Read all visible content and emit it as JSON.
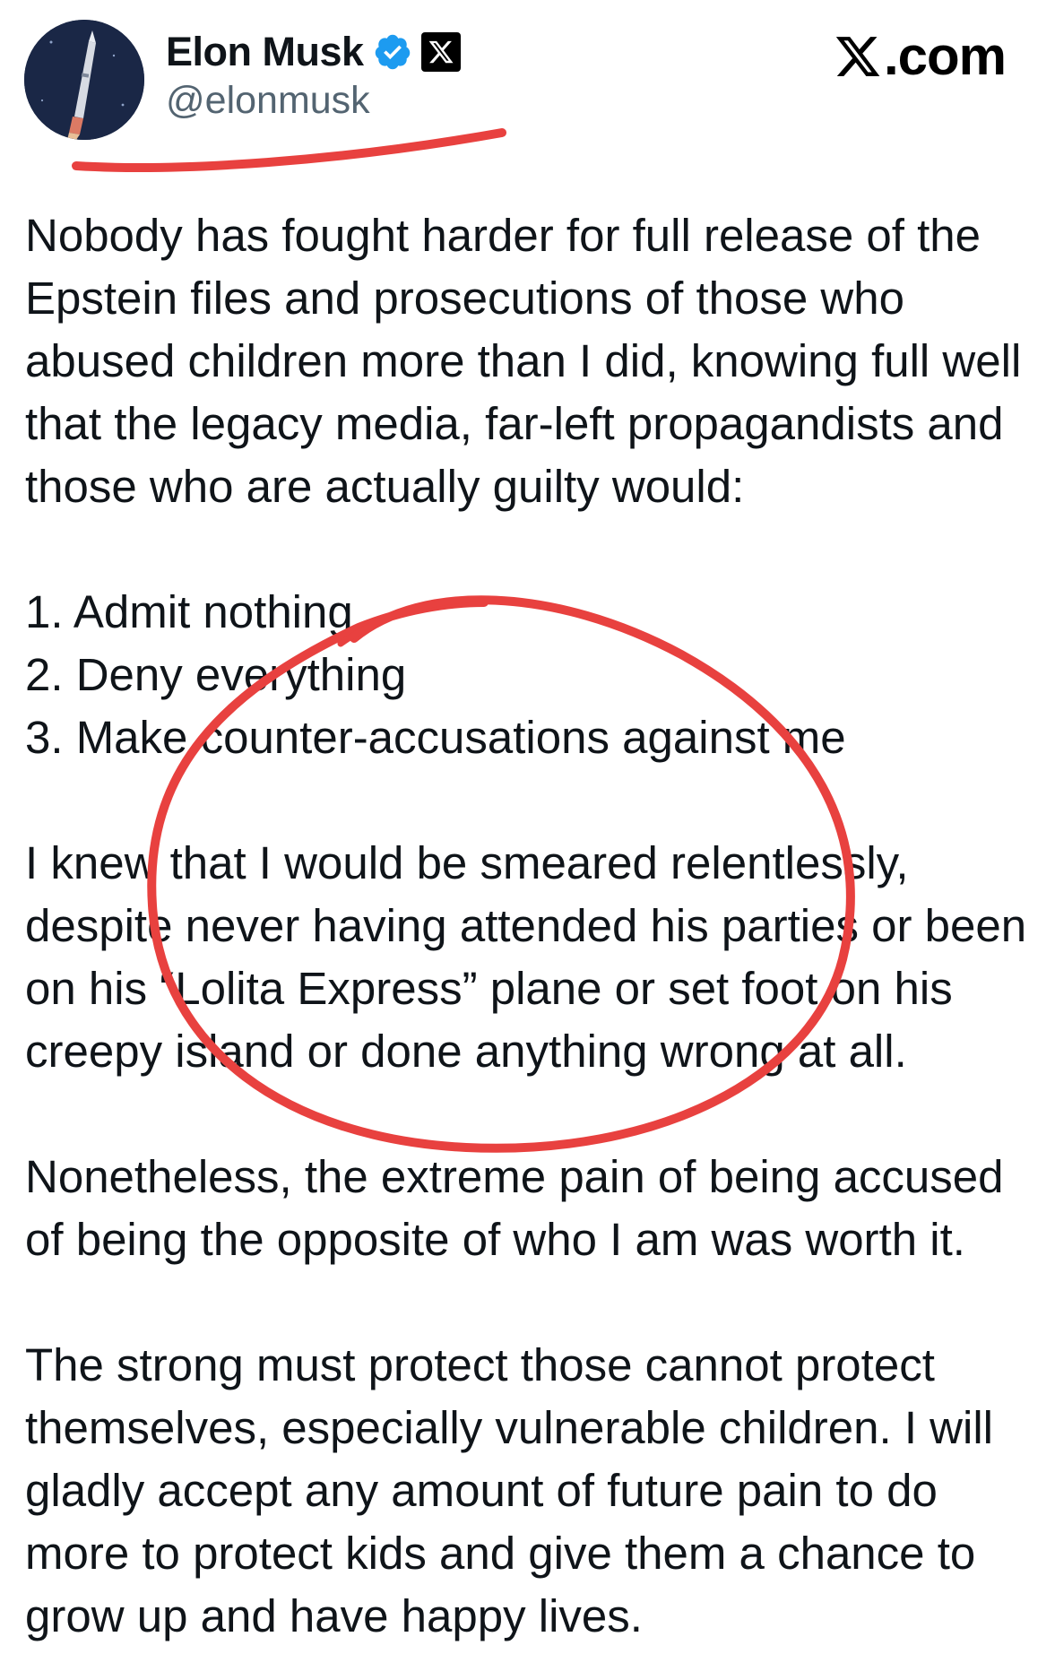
{
  "author": {
    "display_name": "Elon Musk",
    "handle": "@elonmusk",
    "badge_icon": "verified-badge-icon",
    "affiliation_icon": "x-logo-icon",
    "avatar_icon": "rocket-avatar"
  },
  "site": {
    "label": ".com",
    "logo_icon": "x-logo-icon"
  },
  "tweet": {
    "paragraph1": "Nobody has fought harder for full release of the\nEpstein files and prosecutions of those who\nabused children more than I did, knowing full well\nthat the legacy media, far-left propagandists and\nthose who are actually guilty would:",
    "list_item1": "1. Admit nothing",
    "list_item2": "2. Deny everything",
    "list_item3": "3. Make counter-accusations against me",
    "paragraph2": "I knew that I would be smeared relentlessly,\ndespite never having attended his parties or been\non his “Lolita Express” plane or set foot on his\ncreepy island or done anything wrong at all.",
    "paragraph3": "Nonetheless, the extreme pain of being accused\nof being the opposite of who I am was worth it.",
    "paragraph4": "The strong must protect those cannot protect\nthemselves, especially vulnerable children. I will\ngladly accept any amount of future pain to do\nmore to protect kids and give them a chance to\ngrow up and have happy lives."
  },
  "colors": {
    "annotation_red": "#e8413f",
    "verified_blue": "#1d9bf0",
    "text": "#0f1419",
    "secondary_text": "#536471"
  }
}
